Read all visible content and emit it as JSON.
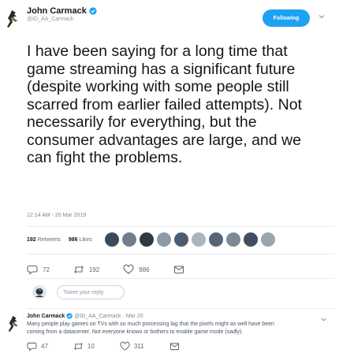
{
  "tweet": {
    "author_name": "John Carmack",
    "author_handle": "@ID_AA_Carmack",
    "follow_label": "Following",
    "text": "I have been saying for a long time that game streaming has a significant future (despite working with some people still scarred from earlier failed attempts). Not necessarily for everything, but the consumer advantages are large, and we can fight the problems.",
    "timestamp": "12:14 AM - 20 Mar 2019",
    "retweets_count": "192",
    "retweets_label": "Retweets",
    "likes_count": "986",
    "likes_label": "Likes",
    "liker_colors": [
      "#3b4a5a",
      "#6d7f8f",
      "#2e3a44",
      "#8a9aa8",
      "#4b5d6e",
      "#a8b5bf",
      "#556677",
      "#7a8a99",
      "#3f4f5f",
      "#98a6b2"
    ],
    "reply_count": "72",
    "retweet_action_count": "192",
    "like_action_count": "986"
  },
  "reply_box": {
    "placeholder": "Tweet your reply"
  },
  "reply": {
    "author_name": "John Carmack",
    "author_handle": "@ID_AA_Carmack",
    "separator": "·",
    "date": "Mar 20",
    "text": "Many people play games on TVs with so much processing lag that the pixels might as well have been coming from a datacenter.  Not everyone knows or bothers to enable game mode (sadly).",
    "reply_count": "47",
    "retweet_count": "10",
    "like_count": "311"
  },
  "colors": {
    "accent": "#1da1f2",
    "text": "#14171a",
    "muted": "#5c6b78",
    "verified": "#1da1f2"
  }
}
